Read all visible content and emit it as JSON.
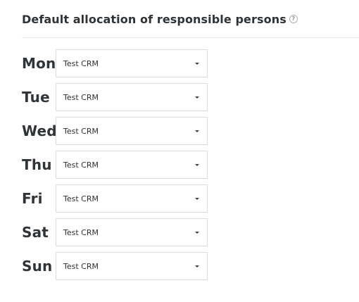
{
  "header": {
    "title": "Default allocation of responsible persons",
    "help_icon": "question-circle-icon",
    "help_glyph": "?"
  },
  "schedule": [
    {
      "day": "Mon",
      "value": "Test CRM"
    },
    {
      "day": "Tue",
      "value": "Test CRM"
    },
    {
      "day": "Wed",
      "value": "Test CRM"
    },
    {
      "day": "Thu",
      "value": "Test CRM"
    },
    {
      "day": "Fri",
      "value": "Test CRM"
    },
    {
      "day": "Sat",
      "value": "Test CRM"
    },
    {
      "day": "Sun",
      "value": "Test CRM"
    }
  ]
}
